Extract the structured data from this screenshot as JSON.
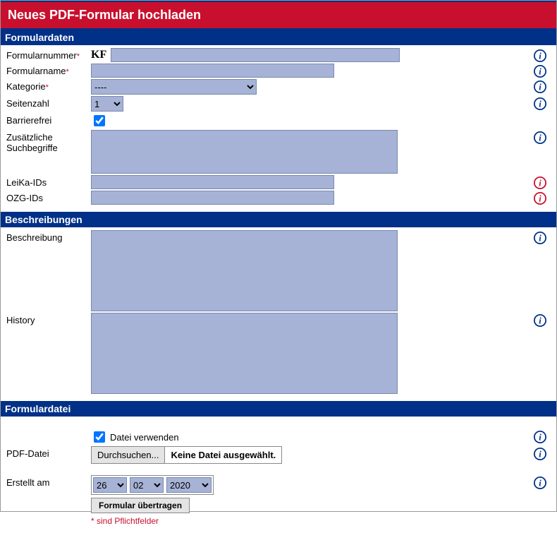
{
  "title": "Neues PDF-Formular hochladen",
  "sections": {
    "formdata": {
      "header": "Formulardaten",
      "formnum": {
        "label": "Formularnummer",
        "prefix": "KF",
        "value": ""
      },
      "formname": {
        "label": "Formularname",
        "value": ""
      },
      "category": {
        "label": "Kategorie",
        "selected": "----"
      },
      "pages": {
        "label": "Seitenzahl",
        "selected": "1"
      },
      "barrierfree": {
        "label": "Barrierefrei",
        "checked": true
      },
      "searchterms": {
        "label": "Zusätzliche Suchbegriffe",
        "value": ""
      },
      "leika": {
        "label": "LeiKa-IDs",
        "value": ""
      },
      "ozg": {
        "label": "OZG-IDs",
        "value": ""
      }
    },
    "descriptions": {
      "header": "Beschreibungen",
      "description": {
        "label": "Beschreibung",
        "value": ""
      },
      "history": {
        "label": "History",
        "value": ""
      }
    },
    "formfile": {
      "header": "Formulardatei",
      "usefile": {
        "label": "Datei verwenden",
        "checked": true
      },
      "pdffile": {
        "label": "PDF-Datei",
        "browse": "Durchsuchen...",
        "status": "Keine Datei ausgewählt."
      },
      "created": {
        "label": "Erstellt am",
        "day": "26",
        "month": "02",
        "year": "2020"
      },
      "submit": "Formular übertragen",
      "mandatory": "* sind Pflichtfelder"
    }
  }
}
